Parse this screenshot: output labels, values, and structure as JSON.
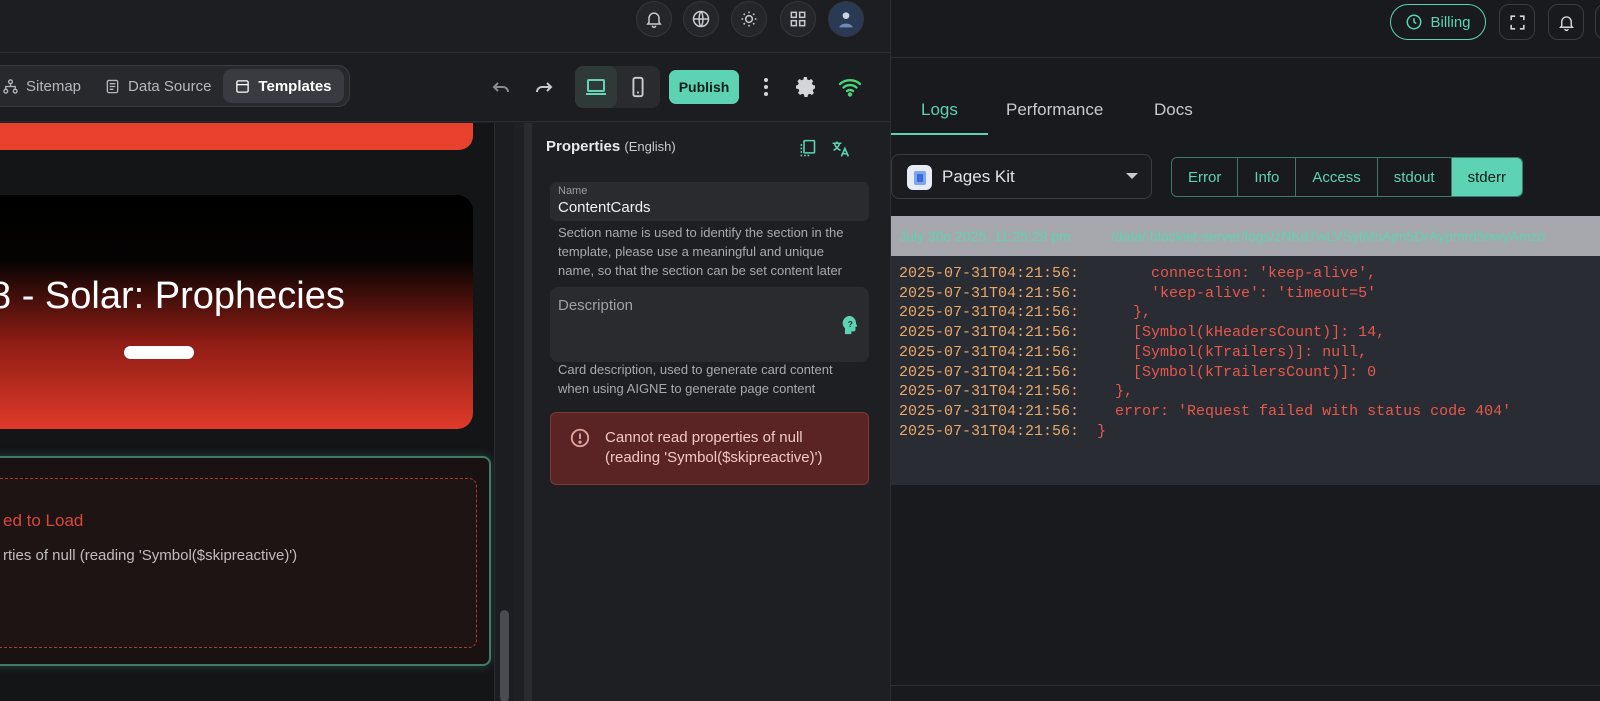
{
  "editor": {
    "topbar_icons": [
      "bell-icon",
      "globe-icon",
      "sun-icon",
      "grid-icon",
      "avatar"
    ],
    "nav_tabs": [
      {
        "label": "Sitemap",
        "icon": "sitemap-icon"
      },
      {
        "label": "Data Source",
        "icon": "database-icon"
      },
      {
        "label": "Templates",
        "icon": "template-icon",
        "active": true
      }
    ],
    "publish_label": "Publish",
    "canvas": {
      "hero_title": "8 - Solar: Prophecies",
      "error_title": "ed to Load",
      "error_message": "rties of null (reading 'Symbol($skipreactive)')"
    },
    "properties": {
      "title": "Properties",
      "language": "(English)",
      "name_label": "Name",
      "name_value": "ContentCards",
      "name_help": "Section name is used to identify the section in the template, please use a meaningful and unique name, so that the section can be set content later",
      "description_placeholder": "Description",
      "description_help": "Card description, used to generate card content when using AIGNE to generate page content",
      "alert_message": "Cannot read properties of null (reading 'Symbol($skipreactive)')"
    }
  },
  "logs": {
    "billing_label": "Billing",
    "tabs": [
      "Logs",
      "Performance",
      "Docs"
    ],
    "active_tab": "Logs",
    "source_select": "Pages Kit",
    "levels": [
      "Error",
      "Info",
      "Access",
      "stdout",
      "stderr"
    ],
    "active_level": "stderr",
    "header_date": "July 30o 2025, 11:25:29 pm",
    "header_path": "/data/.blocklet-server/logs/zNKd7wLVSytMnAjm5DrAypmrd5nwyAmzo",
    "lines": [
      {
        "ts": "2025-07-31T04:21:56:",
        "msg": "      connection: 'keep-alive',"
      },
      {
        "ts": "2025-07-31T04:21:56:",
        "msg": "      'keep-alive': 'timeout=5'"
      },
      {
        "ts": "2025-07-31T04:21:56:",
        "msg": "    },"
      },
      {
        "ts": "2025-07-31T04:21:56:",
        "msg": "    [Symbol(kHeadersCount)]: 14,"
      },
      {
        "ts": "2025-07-31T04:21:56:",
        "msg": "    [Symbol(kTrailers)]: null,"
      },
      {
        "ts": "2025-07-31T04:21:56:",
        "msg": "    [Symbol(kTrailersCount)]: 0"
      },
      {
        "ts": "2025-07-31T04:21:56:",
        "msg": "  },"
      },
      {
        "ts": "2025-07-31T04:21:56:",
        "msg": "  error: 'Request failed with status code 404'"
      },
      {
        "ts": "2025-07-31T04:21:56:",
        "msg": "}"
      }
    ]
  },
  "colors": {
    "accent": "#5ed3b4",
    "error": "#e6584d",
    "timestamp": "#e8a96a"
  }
}
